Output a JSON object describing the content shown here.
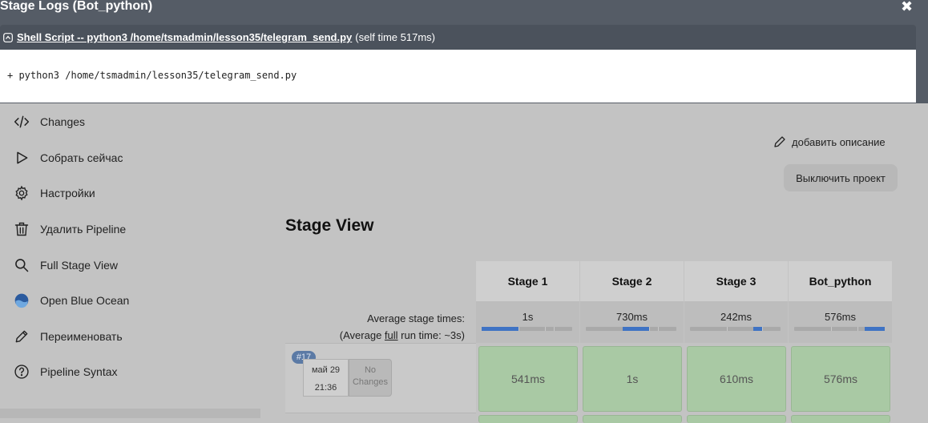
{
  "modal": {
    "title": "Stage Logs (Bot_python)",
    "close_label": "✖",
    "step_link": "Shell Script -- python3 /home/tsmadmin/lesson35/telegram_send.py",
    "self_time": "(self time 517ms)",
    "console_output": "+ python3 /home/tsmadmin/lesson35/telegram_send.py"
  },
  "sidebar": {
    "items": [
      {
        "label": "Changes",
        "icon": "code-icon"
      },
      {
        "label": "Собрать сейчас",
        "icon": "play-icon"
      },
      {
        "label": "Настройки",
        "icon": "gear-icon"
      },
      {
        "label": "Удалить Pipeline",
        "icon": "trash-icon"
      },
      {
        "label": "Full Stage View",
        "icon": "search-icon"
      },
      {
        "label": "Open Blue Ocean",
        "icon": "blue-ocean-icon"
      },
      {
        "label": "Переименовать",
        "icon": "pencil-icon"
      },
      {
        "label": "Pipeline Syntax",
        "icon": "help-icon"
      }
    ]
  },
  "actions": {
    "add_description": "добавить описание",
    "disable_project": "Выключить проект"
  },
  "stage_view": {
    "title": "Stage View",
    "avg_label_1": "Average stage times:",
    "avg_label_2_prefix": "(Average ",
    "avg_label_2_full": "full",
    "avg_label_2_suffix": " run time: ~3s)",
    "stages": [
      {
        "name": "Stage 1",
        "avg": "1s",
        "bar_from": 0.0,
        "bar_to": 0.41
      },
      {
        "name": "Stage 2",
        "avg": "730ms",
        "bar_from": 0.41,
        "bar_to": 0.7
      },
      {
        "name": "Stage 3",
        "avg": "242ms",
        "bar_from": 0.7,
        "bar_to": 0.8
      },
      {
        "name": "Bot_python",
        "avg": "576ms",
        "bar_from": 0.78,
        "bar_to": 1.0
      }
    ],
    "build": {
      "number": "#17",
      "date": "май 29",
      "time": "21:36",
      "changes": "No Changes",
      "stage_times": [
        "541ms",
        "1s",
        "610ms",
        "576ms"
      ]
    }
  },
  "colors": {
    "modal_header": "#555c66",
    "stage_success": "#a9c9a4",
    "progress": "#3f73c4"
  }
}
